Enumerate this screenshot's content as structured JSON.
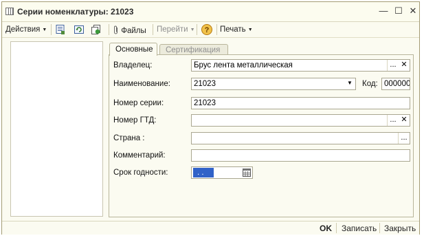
{
  "window": {
    "title": "Серии номенклатуры: 21023",
    "minimize_glyph": "—",
    "maximize_glyph": "☐",
    "close_glyph": "✕"
  },
  "toolbar": {
    "actions_label": "Действия",
    "files_label": "Файлы",
    "goto_label": "Перейти",
    "help_glyph": "?",
    "print_label": "Печать",
    "dropdown_glyph": "▼"
  },
  "tabs": [
    {
      "label": "Основные",
      "active": true
    },
    {
      "label": "Сертификация",
      "active": false
    }
  ],
  "form": {
    "owner": {
      "label": "Владелец:",
      "value": "Брус лента металлическая"
    },
    "name": {
      "label": "Наименование:",
      "value": "21023",
      "code_label": "Код:",
      "code_value": "000000"
    },
    "serial": {
      "label": "Номер серии:",
      "value": "21023"
    },
    "gtd": {
      "label": "Номер ГТД:",
      "value": ""
    },
    "country": {
      "label": "Страна :",
      "value": ""
    },
    "comment": {
      "label": "Комментарий:",
      "value": ""
    },
    "expiry": {
      "label": "Срок годности:",
      "value": ". ."
    }
  },
  "field_buttons": {
    "select_glyph": "...",
    "clear_glyph": "✕",
    "dropdown_glyph": "▼"
  },
  "footer": {
    "ok_label": "OK",
    "save_label": "Записать",
    "close_label": "Закрыть"
  },
  "colors": {
    "window_bg": "#fbfbf1",
    "date_selection": "#3162c8",
    "help_icon": "#e3a526"
  }
}
